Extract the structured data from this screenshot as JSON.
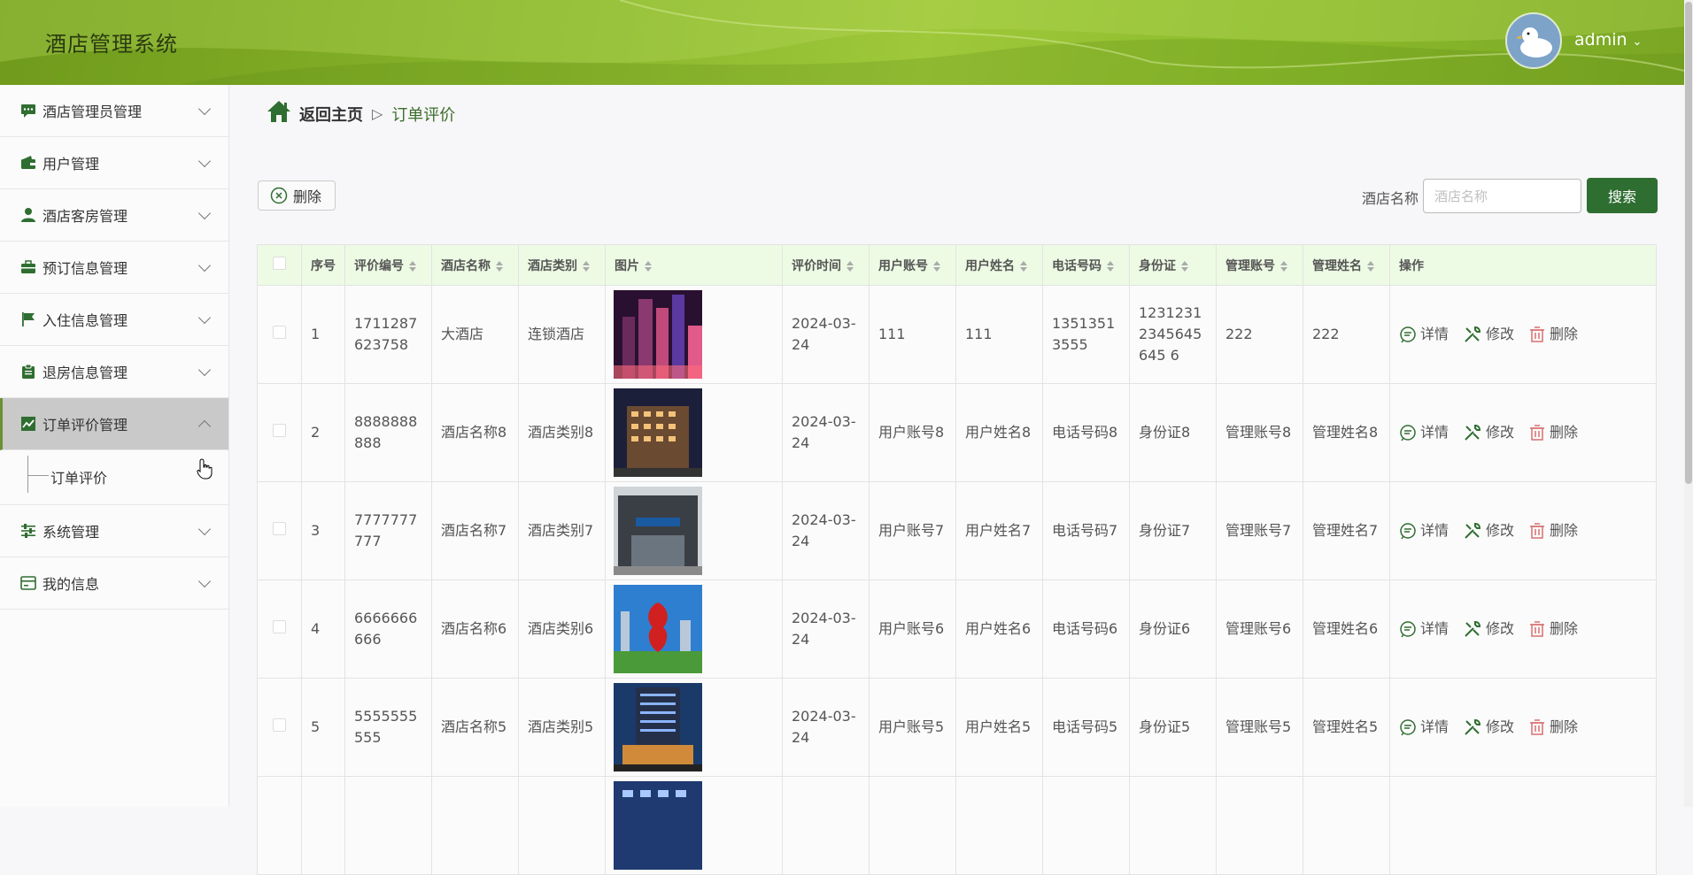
{
  "app": {
    "title": "酒店管理系统"
  },
  "user": {
    "name": "admin",
    "chevron": "⌄"
  },
  "sidebar": {
    "items": [
      {
        "label": "酒店管理员管理",
        "icon": "chat-icon"
      },
      {
        "label": "用户管理",
        "icon": "wallet-icon"
      },
      {
        "label": "酒店客房管理",
        "icon": "user-icon"
      },
      {
        "label": "预订信息管理",
        "icon": "briefcase-icon"
      },
      {
        "label": "入住信息管理",
        "icon": "flag-icon"
      },
      {
        "label": "退房信息管理",
        "icon": "clipboard-icon"
      },
      {
        "label": "订单评价管理",
        "icon": "chart-icon",
        "active": true
      },
      {
        "label": "系统管理",
        "icon": "sliders-icon"
      },
      {
        "label": "我的信息",
        "icon": "card-icon"
      }
    ],
    "submenu": {
      "label": "订单评价"
    }
  },
  "breadcrumb": {
    "home": "返回主页",
    "separator": "▷",
    "current": "订单评价"
  },
  "toolbar": {
    "delete_label": "删除",
    "search_label": "酒店名称",
    "search_placeholder": "酒店名称",
    "search_button": "搜索"
  },
  "table": {
    "headers": [
      "序号",
      "评价编号",
      "酒店名称",
      "酒店类别",
      "图片",
      "评价时间",
      "用户账号",
      "用户姓名",
      "电话号码",
      "身份证",
      "管理账号",
      "管理姓名",
      "操作"
    ],
    "rows": [
      {
        "idx": "1",
        "code": "1711287623758",
        "hotel": "大酒店",
        "category": "连锁酒店",
        "time": "2024-03-24",
        "account": "111",
        "name": "111",
        "phone": "13513513555",
        "idcard": "12312312345645645 6",
        "mgr_account": "222",
        "mgr_name": "222",
        "img": "city-night"
      },
      {
        "idx": "2",
        "code": "8888888888",
        "hotel": "酒店名称8",
        "category": "酒店类别8",
        "time": "2024-03-24",
        "account": "用户账号8",
        "name": "用户姓名8",
        "phone": "电话号码8",
        "idcard": "身份证8",
        "mgr_account": "管理账号8",
        "mgr_name": "管理姓名8",
        "img": "hotel-night"
      },
      {
        "idx": "3",
        "code": "7777777777",
        "hotel": "酒店名称7",
        "category": "酒店类别7",
        "time": "2024-03-24",
        "account": "用户账号7",
        "name": "用户姓名7",
        "phone": "电话号码7",
        "idcard": "身份证7",
        "mgr_account": "管理账号7",
        "mgr_name": "管理姓名7",
        "img": "hotel-entrance"
      },
      {
        "idx": "4",
        "code": "6666666666",
        "hotel": "酒店名称6",
        "category": "酒店类别6",
        "time": "2024-03-24",
        "account": "用户账号6",
        "name": "用户姓名6",
        "phone": "电话号码6",
        "idcard": "身份证6",
        "mgr_account": "管理账号6",
        "mgr_name": "管理姓名6",
        "img": "red-sculpture"
      },
      {
        "idx": "5",
        "code": "5555555555",
        "hotel": "酒店名称5",
        "category": "酒店类别5",
        "time": "2024-03-24",
        "account": "用户账号5",
        "name": "用户姓名5",
        "phone": "电话号码5",
        "idcard": "身份证5",
        "mgr_account": "管理账号5",
        "mgr_name": "管理姓名5",
        "img": "tower-dusk"
      }
    ],
    "ops": {
      "detail": "详情",
      "edit": "修改",
      "delete": "删除"
    }
  },
  "colors": {
    "accent": "#2f6e31",
    "header_green": "#8cbc2c",
    "table_header": "#edfbe4"
  }
}
